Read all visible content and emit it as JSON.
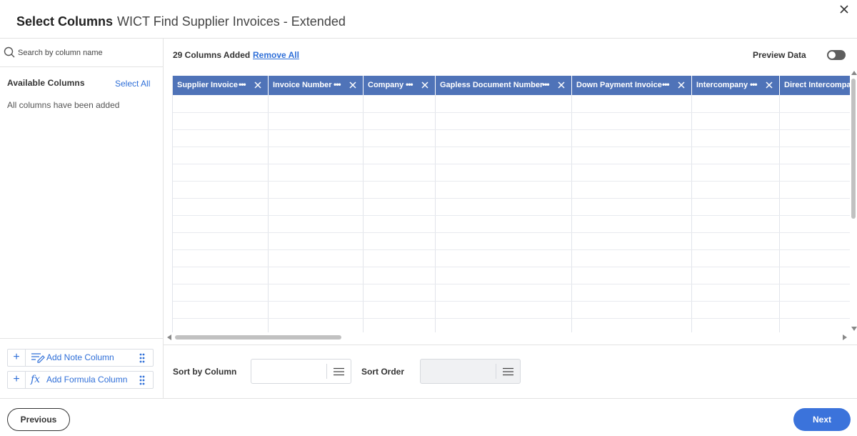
{
  "dialog": {
    "title_strong": "Select Columns",
    "title_sub": "WICT Find Supplier Invoices - Extended"
  },
  "sidebar": {
    "search_placeholder": "Search by column name",
    "available_label": "Available Columns",
    "select_all": "Select All",
    "status": "All columns have been added",
    "add_note": "Add Note Column",
    "add_formula": "Add Formula Column",
    "formula_icon": "fx"
  },
  "main": {
    "count": "29 Columns Added",
    "remove_all": "Remove All",
    "preview_label": "Preview Data",
    "preview_on": false
  },
  "grid": {
    "columns": [
      "Supplier Invoice",
      "Invoice Number",
      "Company",
      "Gapless Document Number",
      "Down Payment Invoice",
      "Intercompany",
      "Direct Intercompany"
    ],
    "header_color": "#4f73b8"
  },
  "sort": {
    "by_label": "Sort by Column",
    "order_label": "Sort Order"
  },
  "footer": {
    "previous": "Previous",
    "next": "Next"
  },
  "colors": {
    "accent": "#3b73db",
    "link": "#2f6fd8"
  }
}
